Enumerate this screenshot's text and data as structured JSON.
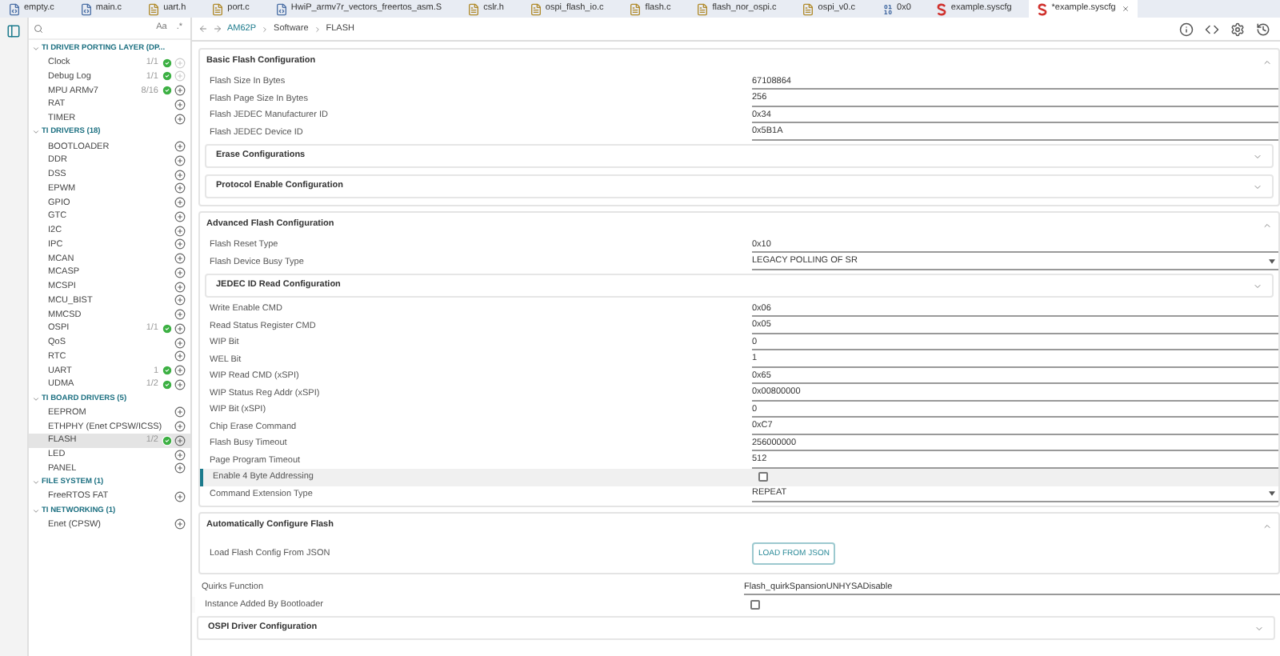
{
  "tabs": [
    {
      "label": "empty.c",
      "kind": "c",
      "selected": false
    },
    {
      "label": "main.c",
      "kind": "c",
      "selected": false
    },
    {
      "label": "uart.h",
      "kind": "h",
      "selected": false
    },
    {
      "label": "port.c",
      "kind": "h",
      "selected": false
    },
    {
      "label": "HwiP_armv7r_vectors_freertos_asm.S",
      "kind": "c",
      "selected": false
    },
    {
      "label": "cslr.h",
      "kind": "h",
      "selected": false
    },
    {
      "label": "ospi_flash_io.c",
      "kind": "h",
      "selected": false
    },
    {
      "label": "flash.c",
      "kind": "h",
      "selected": false
    },
    {
      "label": "flash_nor_ospi.c",
      "kind": "h",
      "selected": false
    },
    {
      "label": "ospi_v0.c",
      "kind": "h",
      "selected": false
    },
    {
      "label": "0x0",
      "kind": "hex",
      "selected": false
    },
    {
      "label": "example.syscfg",
      "kind": "sys",
      "selected": false
    },
    {
      "label": "*example.syscfg",
      "kind": "sys",
      "selected": true
    }
  ],
  "sidebar": {
    "search": {
      "toggles": [
        "Aa",
        ".*"
      ]
    },
    "groups": [
      {
        "title": "TI DRIVER PORTING LAYER (DP...",
        "expanded": true,
        "items": [
          {
            "label": "Clock",
            "count": "1/1",
            "ok": true,
            "can_add": false,
            "selected": false
          },
          {
            "label": "Debug Log",
            "count": "1/1",
            "ok": true,
            "can_add": false,
            "selected": false
          },
          {
            "label": "MPU ARMv7",
            "count": "8/16",
            "ok": true,
            "can_add": true,
            "selected": false
          },
          {
            "label": "RAT",
            "ok": false,
            "can_add": true,
            "selected": false
          },
          {
            "label": "TIMER",
            "ok": false,
            "can_add": true,
            "selected": false
          }
        ]
      },
      {
        "title": "TI DRIVERS (18)",
        "expanded": true,
        "items": [
          {
            "label": "BOOTLOADER",
            "ok": false,
            "can_add": true,
            "selected": false
          },
          {
            "label": "DDR",
            "ok": false,
            "can_add": true,
            "selected": false
          },
          {
            "label": "DSS",
            "ok": false,
            "can_add": true,
            "selected": false
          },
          {
            "label": "EPWM",
            "ok": false,
            "can_add": true,
            "selected": false
          },
          {
            "label": "GPIO",
            "ok": false,
            "can_add": true,
            "selected": false
          },
          {
            "label": "GTC",
            "ok": false,
            "can_add": true,
            "selected": false
          },
          {
            "label": "I2C",
            "ok": false,
            "can_add": true,
            "selected": false
          },
          {
            "label": "IPC",
            "ok": false,
            "can_add": true,
            "selected": false
          },
          {
            "label": "MCAN",
            "ok": false,
            "can_add": true,
            "selected": false
          },
          {
            "label": "MCASP",
            "ok": false,
            "can_add": true,
            "selected": false
          },
          {
            "label": "MCSPI",
            "ok": false,
            "can_add": true,
            "selected": false
          },
          {
            "label": "MCU_BIST",
            "ok": false,
            "can_add": true,
            "selected": false
          },
          {
            "label": "MMCSD",
            "ok": false,
            "can_add": true,
            "selected": false
          },
          {
            "label": "OSPI",
            "count": "1/1",
            "ok": true,
            "can_add": true,
            "selected": false
          },
          {
            "label": "QoS",
            "ok": false,
            "can_add": true,
            "selected": false
          },
          {
            "label": "RTC",
            "ok": false,
            "can_add": true,
            "selected": false
          },
          {
            "label": "UART",
            "count": "1",
            "ok": true,
            "can_add": true,
            "selected": false
          },
          {
            "label": "UDMA",
            "count": "1/2",
            "ok": true,
            "can_add": true,
            "selected": false
          }
        ]
      },
      {
        "title": "TI BOARD DRIVERS (5)",
        "expanded": true,
        "items": [
          {
            "label": "EEPROM",
            "ok": false,
            "can_add": true,
            "selected": false
          },
          {
            "label": "ETHPHY (Enet CPSW/ICSS)",
            "ok": false,
            "can_add": true,
            "selected": false
          },
          {
            "label": "FLASH",
            "count": "1/2",
            "ok": true,
            "can_add": true,
            "selected": true
          },
          {
            "label": "LED",
            "ok": false,
            "can_add": true,
            "selected": false
          },
          {
            "label": "PANEL",
            "ok": false,
            "can_add": true,
            "selected": false
          }
        ]
      },
      {
        "title": "FILE SYSTEM (1)",
        "expanded": true,
        "items": [
          {
            "label": "FreeRTOS FAT",
            "ok": false,
            "can_add": true,
            "selected": false
          }
        ]
      },
      {
        "title": "TI NETWORKING (1)",
        "expanded": true,
        "items": [
          {
            "label": "Enet (CPSW)",
            "ok": false,
            "can_add": true,
            "selected": false
          }
        ]
      }
    ]
  },
  "breadcrumb": [
    "AM62P",
    "Software",
    "FLASH"
  ],
  "content": [
    {
      "kind": "section",
      "title": "Basic Flash Configuration",
      "expanded": true,
      "rows": [
        {
          "kind": "text",
          "label": "Flash Size In Bytes",
          "value": "67108864"
        },
        {
          "kind": "text",
          "label": "Flash Page Size In Bytes",
          "value": "256"
        },
        {
          "kind": "text",
          "label": "Flash JEDEC Manufacturer ID",
          "value": "0x34"
        },
        {
          "kind": "text",
          "label": "Flash JEDEC Device ID",
          "value": "0x5B1A"
        },
        {
          "kind": "subsection",
          "title": "Erase Configurations",
          "expanded": false
        },
        {
          "kind": "subsection",
          "title": "Protocol Enable Configuration",
          "expanded": false
        }
      ]
    },
    {
      "kind": "section",
      "title": "Advanced Flash Configuration",
      "expanded": true,
      "rows": [
        {
          "kind": "text",
          "label": "Flash Reset Type",
          "value": "0x10"
        },
        {
          "kind": "select",
          "label": "Flash Device Busy Type",
          "value": "LEGACY POLLING OF SR"
        },
        {
          "kind": "subsection",
          "title": "JEDEC ID Read Configuration",
          "expanded": false
        },
        {
          "kind": "text",
          "label": "Write Enable CMD",
          "value": "0x06"
        },
        {
          "kind": "text",
          "label": "Read Status Register CMD",
          "value": "0x05"
        },
        {
          "kind": "text",
          "label": "WIP Bit",
          "value": "0"
        },
        {
          "kind": "text",
          "label": "WEL Bit",
          "value": "1"
        },
        {
          "kind": "text",
          "label": "WIP Read CMD (xSPI)",
          "value": "0x65"
        },
        {
          "kind": "text",
          "label": "WIP Status Reg Addr (xSPI)",
          "value": "0x00800000"
        },
        {
          "kind": "text",
          "label": "WIP Bit (xSPI)",
          "value": "0"
        },
        {
          "kind": "text",
          "label": "Chip Erase Command",
          "value": "0xC7"
        },
        {
          "kind": "text",
          "label": "Flash Busy Timeout",
          "value": "256000000"
        },
        {
          "kind": "text",
          "label": "Page Program Timeout",
          "value": "512"
        },
        {
          "kind": "checkbox",
          "label": "Enable 4 Byte Addressing",
          "checked": false,
          "focused": true
        },
        {
          "kind": "select",
          "label": "Command Extension Type",
          "value": "REPEAT"
        }
      ]
    },
    {
      "kind": "section",
      "title": "Automatically Configure Flash",
      "expanded": true,
      "rows": [
        {
          "kind": "button",
          "label": "Load Flash Config From JSON",
          "button": "LOAD FROM JSON"
        }
      ]
    },
    {
      "kind": "text",
      "label": "Quirks Function",
      "value": "Flash_quirkSpansionUNHYSADisable"
    },
    {
      "kind": "checkbox",
      "label": "Instance Added By Bootloader",
      "checked": false,
      "focused": false
    },
    {
      "kind": "subsection",
      "title": "OSPI Driver Configuration",
      "expanded": false
    }
  ]
}
